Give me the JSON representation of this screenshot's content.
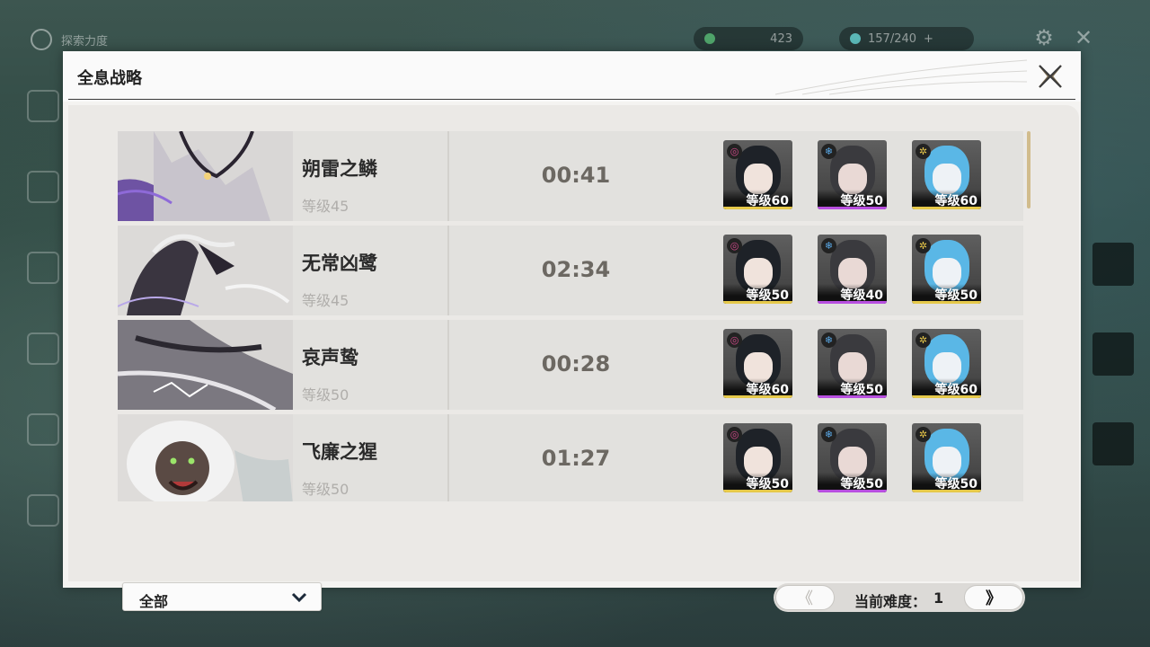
{
  "hud": {
    "top_left_label": "探索力度",
    "currency_1": "423",
    "currency_2": "157/240"
  },
  "panel": {
    "title": "全息战略"
  },
  "rows": [
    {
      "name": "朔雷之鳞",
      "level": "等级45",
      "time": "00:41",
      "chars": [
        {
          "element": "havoc",
          "level": "等级60"
        },
        {
          "element": "glacio",
          "level": "等级50"
        },
        {
          "element": "spectro",
          "level": "等级60"
        }
      ]
    },
    {
      "name": "无常凶鹭",
      "level": "等级45",
      "time": "02:34",
      "chars": [
        {
          "element": "havoc",
          "level": "等级50"
        },
        {
          "element": "glacio",
          "level": "等级40"
        },
        {
          "element": "spectro",
          "level": "等级50"
        }
      ]
    },
    {
      "name": "哀声鸷",
      "level": "等级50",
      "time": "00:28",
      "chars": [
        {
          "element": "havoc",
          "level": "等级60"
        },
        {
          "element": "glacio",
          "level": "等级50"
        },
        {
          "element": "spectro",
          "level": "等级60"
        }
      ]
    },
    {
      "name": "飞廉之猩",
      "level": "等级50",
      "time": "01:27",
      "chars": [
        {
          "element": "havoc",
          "level": "等级50"
        },
        {
          "element": "glacio",
          "level": "等级50"
        },
        {
          "element": "spectro",
          "level": "等级50"
        }
      ]
    }
  ],
  "filter": {
    "selected": "全部"
  },
  "pager": {
    "prev_glyph": "《",
    "next_glyph": "》",
    "label": "当前难度：",
    "value": "1"
  },
  "colors": {
    "havoc": "#d24a8c",
    "glacio": "#5aa8e6",
    "spectro": "#e8c84a",
    "accent_gold": "#d1bc8c"
  }
}
